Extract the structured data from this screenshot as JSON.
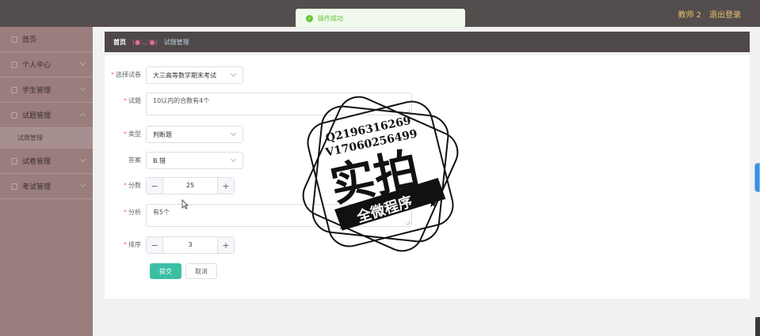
{
  "header": {
    "user_name": "教师 2",
    "logout_label": "退出登录"
  },
  "toast": {
    "message": "操作成功"
  },
  "sidebar": {
    "items": [
      {
        "label": "首页"
      },
      {
        "label": "个人中心"
      },
      {
        "label": "学生管理"
      },
      {
        "label": "试题管理"
      },
      {
        "label": "试卷管理"
      },
      {
        "label": "考试管理"
      }
    ],
    "sub_item": "试题管理"
  },
  "breadcrumb": {
    "home": "首页",
    "face": "(●'◡'●)",
    "current": "试题管理"
  },
  "form": {
    "paper_label": "选择试卷",
    "paper_value": "大三高等数学期末考试",
    "question_label": "试题",
    "question_value": "10以内的合数有4个",
    "type_label": "类型",
    "type_value": "判断题",
    "answer_label": "答案",
    "answer_value": "B.错",
    "score_label": "分数",
    "score_value": "25",
    "analysis_label": "分析",
    "analysis_value": "有5个",
    "order_label": "排序",
    "order_value": "3",
    "required_mark": "*",
    "minus": "−",
    "plus": "+",
    "submit_label": "提交",
    "cancel_label": "取消"
  },
  "watermark": {
    "line1": "Q2196316269",
    "line2": "V17060256499",
    "main": "实拍",
    "banner": "全微程序"
  }
}
